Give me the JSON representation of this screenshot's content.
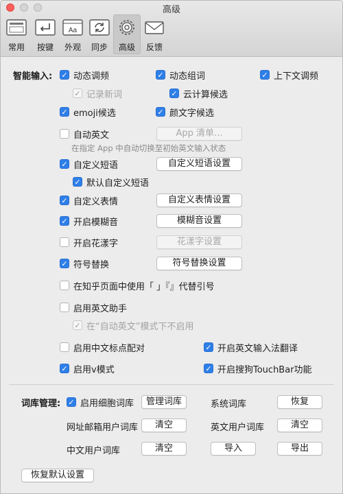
{
  "window": {
    "title": "高级"
  },
  "toolbar": {
    "items": [
      {
        "label": "常用",
        "icon": "general-icon"
      },
      {
        "label": "按键",
        "icon": "keys-icon"
      },
      {
        "label": "外观",
        "icon": "appearance-icon"
      },
      {
        "label": "同步",
        "icon": "sync-icon"
      },
      {
        "label": "高级",
        "icon": "gear-icon",
        "active": true
      },
      {
        "label": "反馈",
        "icon": "mail-icon"
      }
    ],
    "appearance_icon_text": "Aa",
    "active_color": "#c9c9c9"
  },
  "smart_input": {
    "section_label": "智能输入:",
    "dynamic_freq": "动态调频",
    "dynamic_group": "动态组词",
    "context_freq": "上下文调频",
    "record_new": "记录新词",
    "cloud_candidates": "云计算候选",
    "emoji": "emoji候选",
    "kaomoji": "颜文字候选",
    "auto_english": "自动英文",
    "app_list_btn": "App 清单...",
    "auto_english_hint": "在指定 App 中自动切换至初始英文输入状态",
    "custom_phrase": "自定义短语",
    "custom_phrase_btn": "自定义短语设置",
    "default_phrase": "默认自定义短语",
    "custom_emoticon": "自定义表情",
    "custom_emoticon_btn": "自定义表情设置",
    "fuzzy": "开启模糊音",
    "fuzzy_btn": "模糊音设置",
    "fancy_text": "开启花漾字",
    "fancy_text_btn": "花漾字设置",
    "symbol_replace": "符号替换",
    "symbol_replace_btn": "符号替换设置",
    "zhihu_quotes": "在知乎页面中使用「 」『』代替引号",
    "english_assistant": "启用英文助手",
    "english_assistant_sub": "在“自动英文”模式下不启用",
    "cn_punct_pair": "启用中文标点配对",
    "english_translate": "开启英文输入法翻译",
    "v_mode": "启用v模式",
    "touchbar": "开启搜狗TouchBar功能"
  },
  "lexicon": {
    "section_label": "词库管理:",
    "cell_lexicon": "启用细胞词库",
    "manage_btn": "管理词库",
    "system_lexicon": "系统词库",
    "restore_btn": "恢复",
    "url_email_lexicon": "网址邮箱用户词库",
    "clear_btn_1": "清空",
    "en_user_lexicon": "英文用户词库",
    "clear_btn_2": "清空",
    "cn_user_lexicon": "中文用户词库",
    "clear_btn_3": "清空",
    "import_btn": "导入",
    "export_btn": "导出"
  },
  "footer": {
    "restore_defaults_btn": "恢复默认设置"
  },
  "colors": {
    "checkbox_accent": "#2f7fe8",
    "close_button": "#fc605c"
  }
}
